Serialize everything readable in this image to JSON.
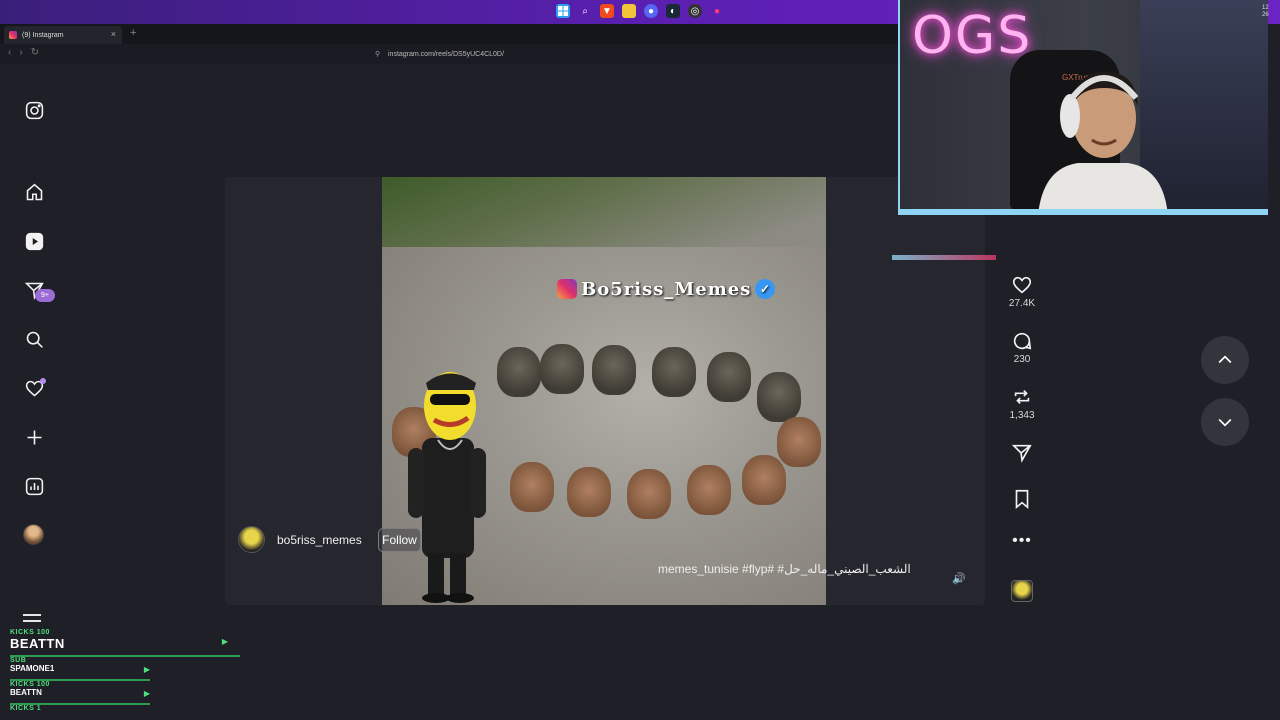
{
  "taskbar": {
    "icons": [
      "windows-start-icon",
      "search-icon",
      "brave-icon",
      "folder-icon",
      "discord-icon",
      "steam-icon",
      "obs-icon",
      "pin-icon"
    ]
  },
  "browser": {
    "tab_title": "(9) Instagram",
    "new_tab": "+",
    "url": "instagram.com/reels/DS5yUC4CL0D/",
    "back": "‹",
    "forward": "›",
    "reload": "↻"
  },
  "sidebar": {
    "items": [
      "instagram-logo",
      "home",
      "reels",
      "messages",
      "search",
      "notifications",
      "create",
      "dashboard",
      "profile",
      "more"
    ],
    "messages_badge": "9+"
  },
  "reel": {
    "overlay_title": "Bo5riss_Memes",
    "author": "bo5riss_memes",
    "follow_label": "Follow",
    "caption": "memes_tunisie #flyp# #الشعب_الصيني_ماله_حل",
    "mute": "🔊"
  },
  "actions": {
    "likes": "27.4K",
    "comments": "230",
    "reposts": "1,343"
  },
  "webcam": {
    "neon_text": "OGS",
    "chair_brand": "GXTrust"
  },
  "clock": {
    "line1": "12",
    "line2": "26"
  },
  "kicks": {
    "row1_small": "KICKS 100",
    "row1_big": "BEATTN",
    "row2_small": "SUB",
    "row2_name": "SPAMONE1",
    "row3_small": "KICKS 100",
    "row3_name": "BEATTN",
    "row4_small": "KICKS 1"
  },
  "colors": {
    "accent": "#4fe07a",
    "taskbar": "#5a1fb0",
    "neon": "#ff4fe0",
    "badge": "#9b6bd6"
  }
}
